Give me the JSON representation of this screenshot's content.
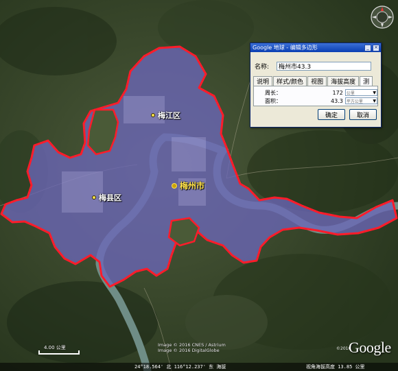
{
  "map": {
    "labels": [
      {
        "id": "meijiang",
        "text": "梅江区"
      },
      {
        "id": "meixian",
        "text": "梅县区"
      },
      {
        "id": "meizhou",
        "text": "梅州市"
      }
    ],
    "colors": {
      "polygon_fill": "#6b66b8",
      "polygon_outline": "#ff1c2a",
      "river": "#6f8d86",
      "terrain": "#3a4a2c"
    },
    "copyright": [
      "Image © 2016 CNES / Astrium",
      "Image © 2016 DigitalGlobe"
    ],
    "google_small": "©2016",
    "google_logo": "Google",
    "scale_label": "4.00 公里"
  },
  "dialog": {
    "title": "Google 地球 - 编辑多边形",
    "name_label": "名称:",
    "name_value": "梅州市43.3",
    "tabs": [
      "说明",
      "样式/颜色",
      "视图",
      "海拔高度",
      "测"
    ],
    "perimeter_label": "周长：",
    "perimeter_value": "172",
    "perimeter_unit": "公里",
    "area_label": "面积：",
    "area_value": "43.3",
    "area_unit": "平方公里",
    "ok": "确定",
    "cancel": "取消"
  },
  "status": {
    "coords": "24°18.564' 北   116°12.237' 东 海拔",
    "right": "视角海拔高度   13.85 公里"
  }
}
